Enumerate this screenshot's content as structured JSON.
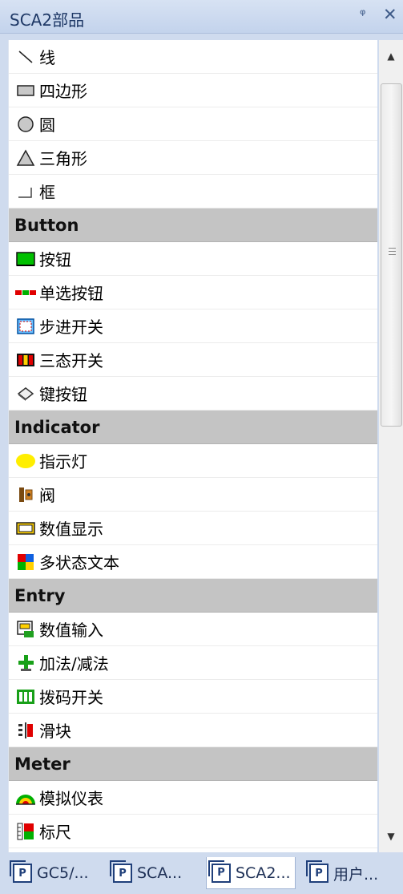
{
  "panel": {
    "title": "SCA2部品",
    "pin_glyph": "ᵠ",
    "close_glyph": "✕"
  },
  "items": [
    {
      "type": "item",
      "label": "线",
      "icon": "line-icon"
    },
    {
      "type": "item",
      "label": "四边形",
      "icon": "rectangle-icon"
    },
    {
      "type": "item",
      "label": "圆",
      "icon": "circle-icon"
    },
    {
      "type": "item",
      "label": "三角形",
      "icon": "triangle-icon"
    },
    {
      "type": "item",
      "label": "框",
      "icon": "frame-icon"
    },
    {
      "type": "category",
      "label": "Button"
    },
    {
      "type": "item",
      "label": "按钮",
      "icon": "button-icon"
    },
    {
      "type": "item",
      "label": "单选按钮",
      "icon": "radio-button-icon"
    },
    {
      "type": "item",
      "label": "步进开关",
      "icon": "step-switch-icon"
    },
    {
      "type": "item",
      "label": "三态开关",
      "icon": "tristate-switch-icon"
    },
    {
      "type": "item",
      "label": "键按钮",
      "icon": "key-button-icon"
    },
    {
      "type": "category",
      "label": "Indicator"
    },
    {
      "type": "item",
      "label": "指示灯",
      "icon": "indicator-lamp-icon"
    },
    {
      "type": "item",
      "label": "阀",
      "icon": "valve-icon"
    },
    {
      "type": "item",
      "label": "数值显示",
      "icon": "numeric-display-icon"
    },
    {
      "type": "item",
      "label": "多状态文本",
      "icon": "multistate-text-icon"
    },
    {
      "type": "category",
      "label": "Entry"
    },
    {
      "type": "item",
      "label": "数值输入",
      "icon": "numeric-input-icon"
    },
    {
      "type": "item",
      "label": "加法/减法",
      "icon": "add-subtract-icon"
    },
    {
      "type": "item",
      "label": "拨码开关",
      "icon": "dip-switch-icon"
    },
    {
      "type": "item",
      "label": "滑块",
      "icon": "slider-icon"
    },
    {
      "type": "category",
      "label": "Meter"
    },
    {
      "type": "item",
      "label": "模拟仪表",
      "icon": "analog-meter-icon"
    },
    {
      "type": "item",
      "label": "标尺",
      "icon": "scale-icon"
    }
  ],
  "scrollbar": {
    "up_glyph": "▲",
    "down_glyph": "▼"
  },
  "tabs": [
    {
      "label": "GC5/...",
      "icon_text": "P",
      "active": false
    },
    {
      "label": "SCA...",
      "icon_text": "P",
      "active": false
    },
    {
      "label": "SCA2...",
      "icon_text": "P",
      "active": true
    },
    {
      "label": "用户...",
      "icon_text": "P",
      "active": false
    }
  ]
}
